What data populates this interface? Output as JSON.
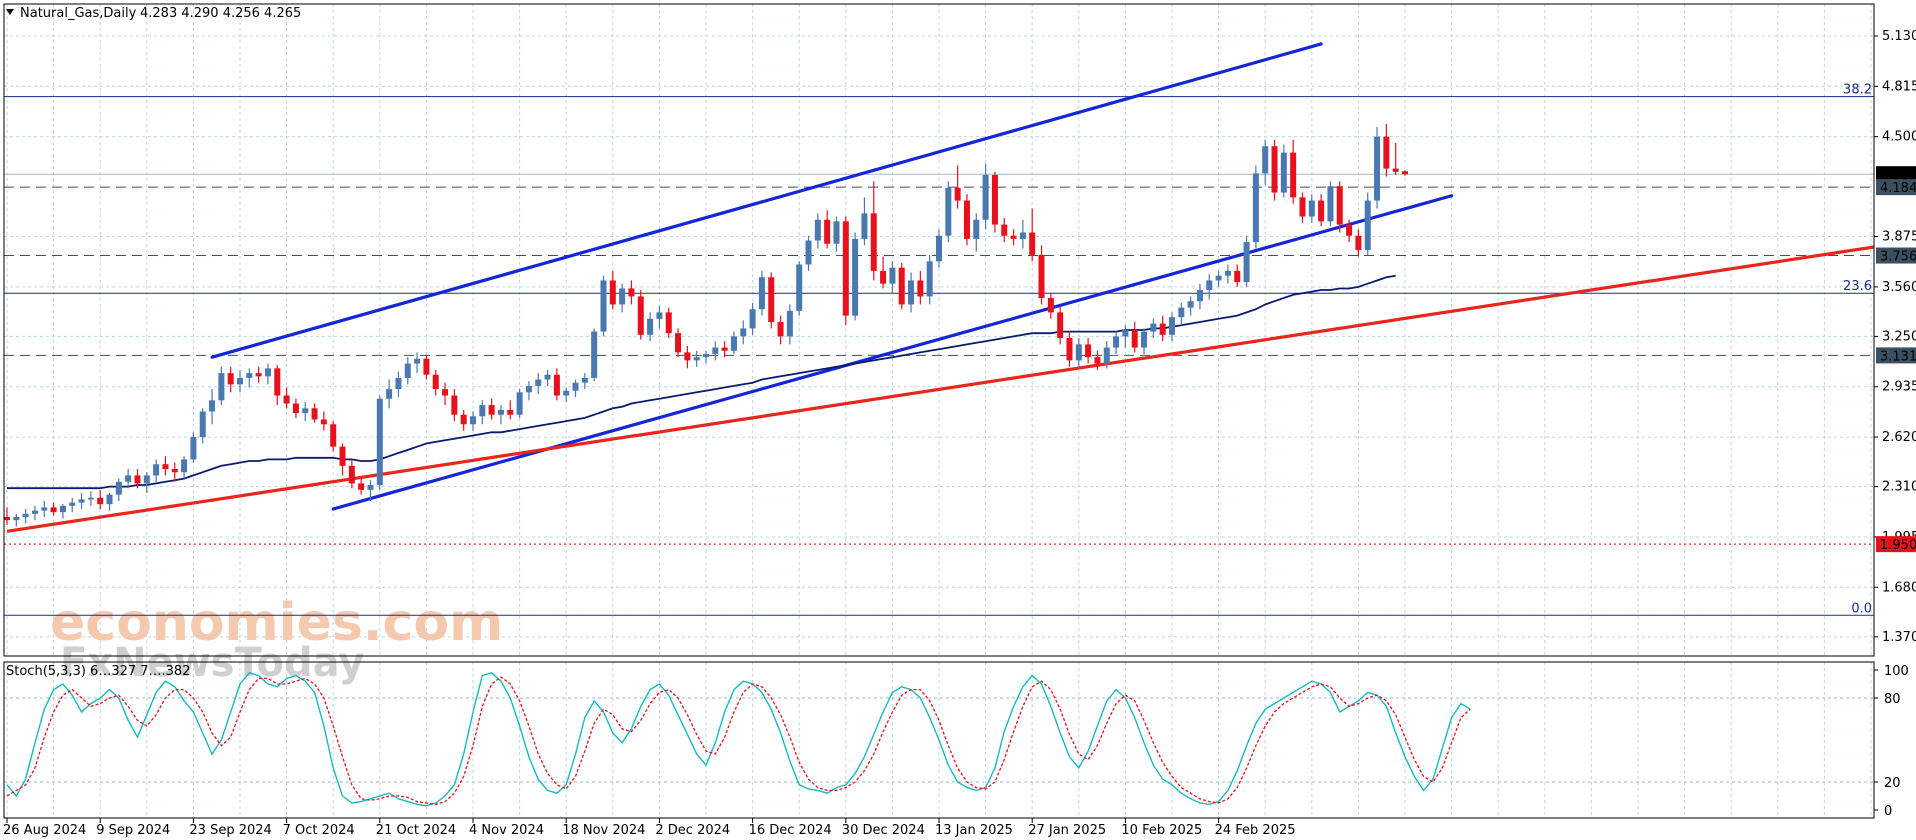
{
  "header": {
    "symbol": "Natural_Gas,Daily",
    "ohlc": "4.283 4.290 4.256 4.265"
  },
  "stoch_header": "Stoch(5,3,3) 6…327 7….382",
  "watermark": {
    "line1": "economies.com",
    "line2": "FxNewsToday"
  },
  "colors": {
    "bull": "#4a78b0",
    "bear": "#e8101c",
    "ma": "#0a1a6e",
    "channel": "#1526d6",
    "redline": "#e8261b",
    "stoch_main": "#17b9c2",
    "stoch_signal": "#e8101c",
    "grid": "#b9d9df"
  },
  "chart_data": {
    "type": "candlestick",
    "instrument": "Natural_Gas",
    "timeframe": "Daily",
    "y_ticks": [
      "5.130",
      "4.815",
      "4.500",
      "3.875",
      "3.560",
      "3.250",
      "2.935",
      "2.620",
      "2.310",
      "1.995",
      "1.680",
      "1.370"
    ],
    "ylim": [
      1.25,
      5.33
    ],
    "x_ticks": [
      {
        "i": 0,
        "label": "26 Aug 2024"
      },
      {
        "i": 10,
        "label": "9 Sep 2024"
      },
      {
        "i": 20,
        "label": "23 Sep 2024"
      },
      {
        "i": 30,
        "label": "7 Oct 2024"
      },
      {
        "i": 40,
        "label": "21 Oct 2024"
      },
      {
        "i": 50,
        "label": "4 Nov 2024"
      },
      {
        "i": 60,
        "label": "18 Nov 2024"
      },
      {
        "i": 70,
        "label": "2 Dec 2024"
      },
      {
        "i": 80,
        "label": "16 Dec 2024"
      },
      {
        "i": 90,
        "label": "30 Dec 2024"
      },
      {
        "i": 100,
        "label": "13 Jan 2025"
      },
      {
        "i": 110,
        "label": "27 Jan 2025"
      },
      {
        "i": 120,
        "label": "10 Feb 2025"
      },
      {
        "i": 130,
        "label": "24 Feb 2025"
      }
    ],
    "candles": [
      [
        2.12,
        2.18,
        2.07,
        2.1
      ],
      [
        2.1,
        2.14,
        2.06,
        2.12
      ],
      [
        2.12,
        2.17,
        2.08,
        2.14
      ],
      [
        2.14,
        2.19,
        2.1,
        2.16
      ],
      [
        2.16,
        2.22,
        2.12,
        2.18
      ],
      [
        2.18,
        2.21,
        2.13,
        2.15
      ],
      [
        2.15,
        2.2,
        2.11,
        2.19
      ],
      [
        2.19,
        2.24,
        2.15,
        2.21
      ],
      [
        2.21,
        2.27,
        2.17,
        2.23
      ],
      [
        2.23,
        2.28,
        2.19,
        2.24
      ],
      [
        2.24,
        2.29,
        2.17,
        2.2
      ],
      [
        2.2,
        2.27,
        2.16,
        2.26
      ],
      [
        2.26,
        2.36,
        2.22,
        2.34
      ],
      [
        2.34,
        2.42,
        2.3,
        2.38
      ],
      [
        2.38,
        2.42,
        2.3,
        2.33
      ],
      [
        2.33,
        2.4,
        2.27,
        2.38
      ],
      [
        2.38,
        2.48,
        2.34,
        2.45
      ],
      [
        2.45,
        2.5,
        2.38,
        2.42
      ],
      [
        2.42,
        2.46,
        2.34,
        2.4
      ],
      [
        2.4,
        2.5,
        2.36,
        2.48
      ],
      [
        2.48,
        2.65,
        2.46,
        2.62
      ],
      [
        2.62,
        2.8,
        2.58,
        2.78
      ],
      [
        2.78,
        2.92,
        2.7,
        2.85
      ],
      [
        2.85,
        3.06,
        2.82,
        3.02
      ],
      [
        3.02,
        3.06,
        2.9,
        2.95
      ],
      [
        2.95,
        3.04,
        2.9,
        2.99
      ],
      [
        2.99,
        3.05,
        2.93,
        3.02
      ],
      [
        3.02,
        3.06,
        2.96,
        3.0
      ],
      [
        3.0,
        3.08,
        2.95,
        3.05
      ],
      [
        3.05,
        3.07,
        2.82,
        2.88
      ],
      [
        2.88,
        2.93,
        2.8,
        2.83
      ],
      [
        2.83,
        2.86,
        2.74,
        2.77
      ],
      [
        2.77,
        2.84,
        2.72,
        2.8
      ],
      [
        2.8,
        2.83,
        2.71,
        2.73
      ],
      [
        2.73,
        2.78,
        2.66,
        2.7
      ],
      [
        2.7,
        2.72,
        2.53,
        2.56
      ],
      [
        2.56,
        2.58,
        2.38,
        2.44
      ],
      [
        2.44,
        2.48,
        2.3,
        2.33
      ],
      [
        2.33,
        2.36,
        2.26,
        2.29
      ],
      [
        2.29,
        2.35,
        2.22,
        2.32
      ],
      [
        2.32,
        2.88,
        2.29,
        2.86
      ],
      [
        2.86,
        2.98,
        2.8,
        2.92
      ],
      [
        2.92,
        3.03,
        2.87,
        2.99
      ],
      [
        2.99,
        3.12,
        2.95,
        3.08
      ],
      [
        3.08,
        3.15,
        3.02,
        3.11
      ],
      [
        3.11,
        3.13,
        2.98,
        3.01
      ],
      [
        3.01,
        3.04,
        2.88,
        2.92
      ],
      [
        2.92,
        2.96,
        2.82,
        2.88
      ],
      [
        2.88,
        2.92,
        2.72,
        2.76
      ],
      [
        2.76,
        2.79,
        2.66,
        2.7
      ],
      [
        2.7,
        2.78,
        2.66,
        2.75
      ],
      [
        2.75,
        2.85,
        2.7,
        2.82
      ],
      [
        2.82,
        2.86,
        2.73,
        2.76
      ],
      [
        2.76,
        2.82,
        2.7,
        2.79
      ],
      [
        2.79,
        2.85,
        2.73,
        2.76
      ],
      [
        2.76,
        2.92,
        2.74,
        2.9
      ],
      [
        2.9,
        2.97,
        2.85,
        2.94
      ],
      [
        2.94,
        3.02,
        2.89,
        2.98
      ],
      [
        2.98,
        3.04,
        2.94,
        3.01
      ],
      [
        3.01,
        3.05,
        2.85,
        2.88
      ],
      [
        2.88,
        2.93,
        2.84,
        2.91
      ],
      [
        2.91,
        2.98,
        2.87,
        2.96
      ],
      [
        2.96,
        3.02,
        2.92,
        2.99
      ],
      [
        2.99,
        3.3,
        2.97,
        3.28
      ],
      [
        3.28,
        3.63,
        3.25,
        3.6
      ],
      [
        3.6,
        3.66,
        3.42,
        3.45
      ],
      [
        3.45,
        3.58,
        3.4,
        3.55
      ],
      [
        3.55,
        3.6,
        3.45,
        3.5
      ],
      [
        3.5,
        3.54,
        3.23,
        3.26
      ],
      [
        3.26,
        3.4,
        3.22,
        3.36
      ],
      [
        3.36,
        3.44,
        3.3,
        3.4
      ],
      [
        3.4,
        3.43,
        3.24,
        3.27
      ],
      [
        3.27,
        3.3,
        3.12,
        3.15
      ],
      [
        3.15,
        3.19,
        3.05,
        3.1
      ],
      [
        3.1,
        3.16,
        3.06,
        3.12
      ],
      [
        3.12,
        3.16,
        3.08,
        3.14
      ],
      [
        3.14,
        3.22,
        3.1,
        3.18
      ],
      [
        3.18,
        3.22,
        3.12,
        3.16
      ],
      [
        3.16,
        3.28,
        3.14,
        3.25
      ],
      [
        3.25,
        3.35,
        3.2,
        3.3
      ],
      [
        3.3,
        3.46,
        3.26,
        3.42
      ],
      [
        3.42,
        3.66,
        3.38,
        3.62
      ],
      [
        3.62,
        3.65,
        3.3,
        3.34
      ],
      [
        3.34,
        3.38,
        3.2,
        3.25
      ],
      [
        3.25,
        3.45,
        3.2,
        3.41
      ],
      [
        3.41,
        3.72,
        3.38,
        3.7
      ],
      [
        3.7,
        3.88,
        3.66,
        3.85
      ],
      [
        3.85,
        4.02,
        3.8,
        3.98
      ],
      [
        3.98,
        4.04,
        3.8,
        3.83
      ],
      [
        3.83,
        4.0,
        3.78,
        3.97
      ],
      [
        3.97,
        4.0,
        3.32,
        3.38
      ],
      [
        3.38,
        3.9,
        3.35,
        3.86
      ],
      [
        3.86,
        4.12,
        3.82,
        4.02
      ],
      [
        4.02,
        4.22,
        3.6,
        3.66
      ],
      [
        3.66,
        3.75,
        3.55,
        3.58
      ],
      [
        3.58,
        3.72,
        3.52,
        3.68
      ],
      [
        3.68,
        3.71,
        3.42,
        3.45
      ],
      [
        3.45,
        3.65,
        3.4,
        3.6
      ],
      [
        3.6,
        3.66,
        3.45,
        3.5
      ],
      [
        3.5,
        3.76,
        3.45,
        3.72
      ],
      [
        3.72,
        3.92,
        3.68,
        3.88
      ],
      [
        3.88,
        4.22,
        3.84,
        4.18
      ],
      [
        4.18,
        4.32,
        4.05,
        4.1
      ],
      [
        4.1,
        4.14,
        3.82,
        3.86
      ],
      [
        3.86,
        4.02,
        3.78,
        3.98
      ],
      [
        3.98,
        4.33,
        3.92,
        4.26
      ],
      [
        4.26,
        4.28,
        3.9,
        3.95
      ],
      [
        3.95,
        3.99,
        3.84,
        3.88
      ],
      [
        3.88,
        3.92,
        3.82,
        3.86
      ],
      [
        3.86,
        3.98,
        3.8,
        3.9
      ],
      [
        3.9,
        4.05,
        3.72,
        3.76
      ],
      [
        3.76,
        3.82,
        3.45,
        3.49
      ],
      [
        3.49,
        3.52,
        3.36,
        3.4
      ],
      [
        3.4,
        3.44,
        3.2,
        3.24
      ],
      [
        3.24,
        3.28,
        3.06,
        3.1
      ],
      [
        3.1,
        3.24,
        3.05,
        3.2
      ],
      [
        3.2,
        3.24,
        3.08,
        3.12
      ],
      [
        3.12,
        3.16,
        3.04,
        3.08
      ],
      [
        3.08,
        3.22,
        3.05,
        3.18
      ],
      [
        3.18,
        3.28,
        3.14,
        3.25
      ],
      [
        3.25,
        3.32,
        3.18,
        3.29
      ],
      [
        3.29,
        3.34,
        3.15,
        3.18
      ],
      [
        3.18,
        3.3,
        3.14,
        3.28
      ],
      [
        3.28,
        3.36,
        3.24,
        3.33
      ],
      [
        3.33,
        3.38,
        3.22,
        3.26
      ],
      [
        3.26,
        3.4,
        3.22,
        3.37
      ],
      [
        3.37,
        3.46,
        3.32,
        3.43
      ],
      [
        3.43,
        3.5,
        3.38,
        3.47
      ],
      [
        3.47,
        3.58,
        3.42,
        3.54
      ],
      [
        3.54,
        3.64,
        3.48,
        3.6
      ],
      [
        3.6,
        3.66,
        3.56,
        3.63
      ],
      [
        3.63,
        3.7,
        3.58,
        3.66
      ],
      [
        3.66,
        3.7,
        3.56,
        3.59
      ],
      [
        3.59,
        3.88,
        3.56,
        3.84
      ],
      [
        3.84,
        4.32,
        3.8,
        4.27
      ],
      [
        4.27,
        4.48,
        4.2,
        4.44
      ],
      [
        4.44,
        4.48,
        4.1,
        4.15
      ],
      [
        4.15,
        4.45,
        4.12,
        4.4
      ],
      [
        4.4,
        4.48,
        4.08,
        4.12
      ],
      [
        4.12,
        4.15,
        3.96,
        4.0
      ],
      [
        4.0,
        4.14,
        3.96,
        4.1
      ],
      [
        4.1,
        4.14,
        3.94,
        3.97
      ],
      [
        3.97,
        4.22,
        3.94,
        4.19
      ],
      [
        4.19,
        4.22,
        3.9,
        3.95
      ],
      [
        3.95,
        3.98,
        3.84,
        3.88
      ],
      [
        3.88,
        3.92,
        3.75,
        3.79
      ],
      [
        3.79,
        4.15,
        3.76,
        4.1
      ],
      [
        4.1,
        4.56,
        4.05,
        4.5
      ],
      [
        4.5,
        4.58,
        4.25,
        4.3
      ],
      [
        4.3,
        4.46,
        4.26,
        4.28
      ],
      [
        4.283,
        4.29,
        4.256,
        4.265
      ]
    ],
    "moving_average": [
      2.3,
      2.3,
      2.3,
      2.3,
      2.3,
      2.3,
      2.3,
      2.3,
      2.3,
      2.3,
      2.3,
      2.31,
      2.31,
      2.31,
      2.32,
      2.32,
      2.33,
      2.34,
      2.35,
      2.36,
      2.38,
      2.4,
      2.42,
      2.44,
      2.45,
      2.46,
      2.47,
      2.47,
      2.48,
      2.48,
      2.48,
      2.49,
      2.49,
      2.49,
      2.49,
      2.49,
      2.48,
      2.48,
      2.47,
      2.47,
      2.48,
      2.5,
      2.52,
      2.54,
      2.56,
      2.58,
      2.59,
      2.6,
      2.61,
      2.62,
      2.63,
      2.64,
      2.65,
      2.65,
      2.66,
      2.67,
      2.68,
      2.69,
      2.7,
      2.71,
      2.72,
      2.73,
      2.74,
      2.76,
      2.78,
      2.8,
      2.81,
      2.83,
      2.84,
      2.85,
      2.86,
      2.87,
      2.88,
      2.89,
      2.9,
      2.91,
      2.92,
      2.93,
      2.94,
      2.95,
      2.96,
      2.98,
      2.99,
      3.0,
      3.01,
      3.02,
      3.03,
      3.04,
      3.05,
      3.06,
      3.07,
      3.08,
      3.09,
      3.1,
      3.11,
      3.12,
      3.13,
      3.14,
      3.15,
      3.16,
      3.17,
      3.18,
      3.19,
      3.2,
      3.21,
      3.22,
      3.23,
      3.24,
      3.25,
      3.26,
      3.27,
      3.27,
      3.27,
      3.28,
      3.28,
      3.28,
      3.28,
      3.28,
      3.28,
      3.28,
      3.29,
      3.29,
      3.29,
      3.3,
      3.3,
      3.31,
      3.32,
      3.33,
      3.34,
      3.35,
      3.36,
      3.37,
      3.38,
      3.4,
      3.42,
      3.45,
      3.47,
      3.49,
      3.51,
      3.52,
      3.53,
      3.54,
      3.54,
      3.55,
      3.55,
      3.56,
      3.58,
      3.6,
      3.62,
      3.63
    ],
    "channel_upper": [
      {
        "i": 22,
        "y": 3.12
      },
      {
        "i": 141,
        "y": 5.08
      }
    ],
    "channel_lower": [
      {
        "i": 35,
        "y": 2.17
      },
      {
        "i": 155,
        "y": 4.13
      }
    ],
    "support_line": [
      {
        "i": 0,
        "y": 2.03
      },
      {
        "i": 188,
        "y": 3.7
      }
    ],
    "horizontal_levels": [
      {
        "y": 4.184,
        "label": "4.184",
        "style": "dashed",
        "tag": "dark"
      },
      {
        "y": 3.756,
        "label": "3.756",
        "style": "dashed",
        "tag": "dark"
      },
      {
        "y": 3.131,
        "label": "3.131",
        "style": "dashed",
        "tag": "dark"
      },
      {
        "y": 1.95,
        "label": "1.950",
        "style": "dotted-red",
        "tag": "red"
      }
    ],
    "fib_levels": [
      {
        "y": 4.75,
        "label": "38.2"
      },
      {
        "y": 3.52,
        "label": "23.6"
      },
      {
        "y": 1.505,
        "label": "0.0"
      }
    ],
    "current_price": {
      "y": 4.265,
      "label": "4.265"
    },
    "stochastic": {
      "name": "Stoch(5,3,3)",
      "y_ticks": [
        "100",
        "80",
        "20",
        "0"
      ],
      "main": [
        18,
        10,
        22,
        48,
        72,
        86,
        90,
        82,
        70,
        76,
        80,
        86,
        80,
        64,
        52,
        68,
        84,
        92,
        88,
        78,
        70,
        55,
        40,
        50,
        70,
        90,
        98,
        96,
        90,
        88,
        94,
        96,
        92,
        84,
        60,
        30,
        10,
        5,
        6,
        8,
        10,
        12,
        8,
        6,
        4,
        3,
        5,
        10,
        18,
        40,
        70,
        96,
        98,
        92,
        80,
        60,
        38,
        22,
        14,
        12,
        18,
        40,
        66,
        78,
        70,
        55,
        48,
        58,
        74,
        86,
        90,
        82,
        68,
        54,
        40,
        32,
        48,
        70,
        86,
        92,
        90,
        84,
        72,
        55,
        35,
        18,
        15,
        14,
        12,
        16,
        18,
        26,
        38,
        54,
        70,
        84,
        88,
        86,
        80,
        66,
        50,
        32,
        20,
        16,
        14,
        16,
        30,
        56,
        74,
        88,
        96,
        90,
        74,
        55,
        38,
        30,
        42,
        60,
        78,
        86,
        80,
        66,
        48,
        32,
        22,
        18,
        12,
        8,
        5,
        4,
        6,
        14,
        28,
        46,
        62,
        72,
        76,
        80,
        84,
        88,
        92,
        90,
        84,
        70,
        74,
        78,
        84,
        82,
        74,
        55,
        38,
        24,
        14,
        22,
        44,
        66,
        76,
        72
      ],
      "signal": [
        10,
        14,
        18,
        30,
        52,
        70,
        82,
        86,
        80,
        74,
        76,
        80,
        82,
        74,
        64,
        60,
        68,
        80,
        86,
        86,
        80,
        70,
        55,
        46,
        52,
        70,
        86,
        94,
        94,
        90,
        90,
        92,
        94,
        90,
        80,
        60,
        38,
        18,
        8,
        7,
        8,
        10,
        10,
        9,
        6,
        5,
        4,
        6,
        12,
        24,
        46,
        74,
        90,
        95,
        90,
        78,
        60,
        40,
        26,
        18,
        15,
        24,
        42,
        62,
        72,
        68,
        58,
        56,
        64,
        76,
        84,
        86,
        80,
        68,
        54,
        42,
        40,
        52,
        70,
        84,
        90,
        88,
        80,
        68,
        52,
        34,
        22,
        16,
        14,
        14,
        16,
        20,
        28,
        40,
        56,
        70,
        82,
        86,
        86,
        78,
        64,
        46,
        30,
        20,
        16,
        15,
        20,
        36,
        56,
        74,
        88,
        92,
        86,
        72,
        54,
        40,
        36,
        46,
        62,
        76,
        82,
        78,
        64,
        48,
        34,
        24,
        16,
        12,
        8,
        6,
        5,
        8,
        16,
        30,
        46,
        60,
        70,
        76,
        80,
        84,
        88,
        90,
        88,
        80,
        74,
        76,
        80,
        82,
        78,
        68,
        52,
        36,
        24,
        20,
        30,
        48,
        66,
        72
      ]
    }
  }
}
